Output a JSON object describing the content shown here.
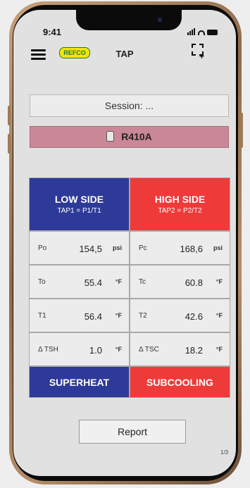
{
  "status_bar": {
    "time": "9:41"
  },
  "header": {
    "logo": "REFCO",
    "title": "TAP",
    "menu_icon": "hamburger-icon",
    "action_icon": "crop-add-icon"
  },
  "session": {
    "label": "Session: ..."
  },
  "refrigerant": {
    "name": "R410A",
    "icon": "cylinder-icon"
  },
  "low_side": {
    "title": "LOW SIDE",
    "subtitle": "TAP1 = P1/T1"
  },
  "high_side": {
    "title": "HIGH SIDE",
    "subtitle": "TAP2 = P2/T2"
  },
  "measurements": [
    {
      "low": {
        "symbol": "Po",
        "value": "154,5",
        "unit": "psi"
      },
      "high": {
        "symbol": "Pc",
        "value": "168,6",
        "unit": "psi"
      }
    },
    {
      "low": {
        "symbol": "To",
        "value": "55.4",
        "unit": "°F"
      },
      "high": {
        "symbol": "Tc",
        "value": "60.8",
        "unit": "°F"
      }
    },
    {
      "low": {
        "symbol": "T1",
        "value": "56.4",
        "unit": "°F"
      },
      "high": {
        "symbol": "T2",
        "value": "42.6",
        "unit": "°F"
      }
    },
    {
      "low": {
        "symbol": "Δ TSH",
        "value": "1.0",
        "unit": "°F"
      },
      "high": {
        "symbol": "Δ TSC",
        "value": "18.2",
        "unit": "°F"
      }
    }
  ],
  "buttons": {
    "superheat": "SUPERHEAT",
    "subcooling": "SUBCOOLING",
    "report": "Report"
  },
  "page_indicator": "1/3",
  "colors": {
    "low_side": "#2e3a98",
    "high_side": "#ef3a3a",
    "refrigerant_bg": "#c98797",
    "logo_bg": "#f2e600"
  }
}
